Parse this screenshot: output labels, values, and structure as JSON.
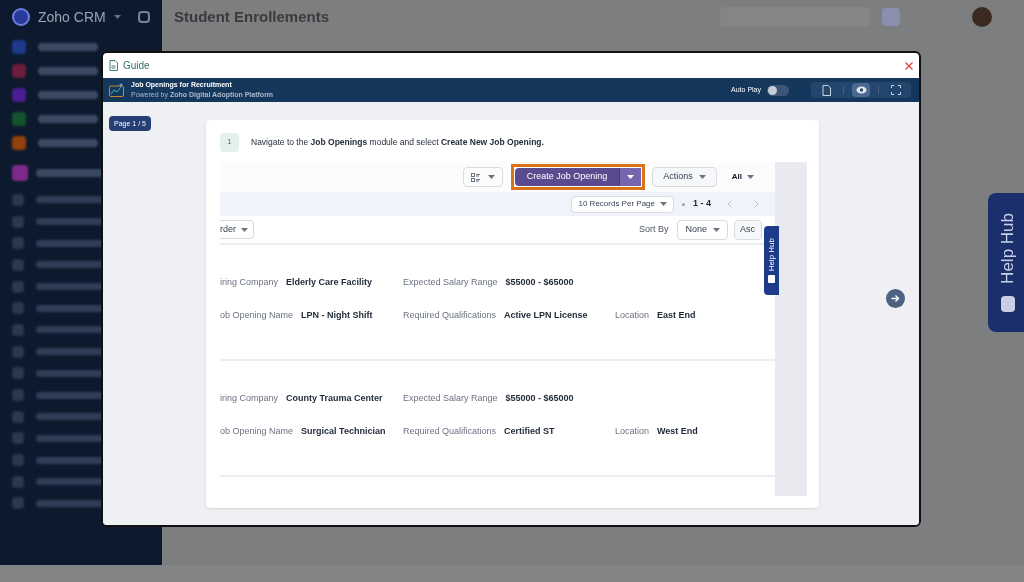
{
  "background": {
    "app_name": "Zoho CRM",
    "module_title": "Student Enrollements",
    "help_hub": "Help Hub"
  },
  "guide": {
    "title": "Guide",
    "banner": {
      "title": "Job Openings for Recruitment",
      "powered_by": "Powered by **Zoho Digital Adoption Platform**"
    },
    "auto_play": {
      "label": "Auto Play",
      "on": false
    },
    "view_modes": [
      {
        "kind": "document",
        "selected": false
      },
      {
        "kind": "eye",
        "selected": true
      },
      {
        "kind": "fullscreen",
        "selected": false
      }
    ],
    "page": "Page 1 / 5",
    "step": {
      "number": "1",
      "text": "Navigate to the **Job Openings** module and select **Create New Job Opening.**"
    }
  },
  "preview": {
    "toolbar": {
      "create_button": "Create Job Opening",
      "actions": "Actions",
      "filter": "All"
    },
    "pagination": {
      "per_page": "10 Records Per Page",
      "range": "1 - 4"
    },
    "sort": {
      "order_dropdown": "rder",
      "label": "Sort By",
      "field": "None",
      "direction": "Asc"
    },
    "help_hub": "Help Hub",
    "records": [
      {
        "rows": [
          [
            {
              "label": "iring Company",
              "value": "Elderly Care Facility"
            },
            {
              "label": "Expected Salary Range",
              "value": "$55000 - $65000"
            }
          ],
          [
            {
              "label": "ob Opening Name",
              "value": "LPN - Night Shift"
            },
            {
              "label": "Required Qualifications",
              "value": "Active LPN License"
            },
            {
              "label": "Location",
              "value": "East End"
            }
          ]
        ]
      },
      {
        "rows": [
          [
            {
              "label": "iring Company",
              "value": "County Trauma Center"
            },
            {
              "label": "Expected Salary Range",
              "value": "$55000 - $65000"
            }
          ],
          [
            {
              "label": "ob Opening Name",
              "value": "Surgical Technician"
            },
            {
              "label": "Required Qualifications",
              "value": "Certified ST"
            },
            {
              "label": "Location",
              "value": "West End"
            }
          ]
        ]
      }
    ]
  }
}
